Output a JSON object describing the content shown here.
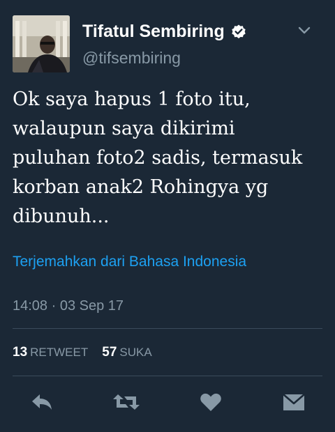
{
  "user": {
    "display_name": "Tifatul Sembiring",
    "handle": "@tifsembiring",
    "verified": true
  },
  "tweet": {
    "lines": [
      "Ok saya hapus 1 foto itu,",
      "walaupun saya dikirimi",
      "puluhan foto2 sadis, termasuk",
      "korban anak2 Rohingya yg",
      "dibunuh..."
    ],
    "translate_link": "Terjemahkan dari Bahasa Indonesia",
    "timestamp": "14:08 · 03 Sep 17"
  },
  "stats": {
    "retweets": "13",
    "retweets_label": "RETWEET",
    "likes": "57",
    "likes_label": "SUKA"
  },
  "actions": [
    "reply-icon",
    "retweet-icon",
    "like-icon",
    "message-icon"
  ],
  "colors": {
    "background": "#1b2836",
    "link": "#1da1f2",
    "muted": "#8899a6",
    "icon": "#8899a6"
  }
}
